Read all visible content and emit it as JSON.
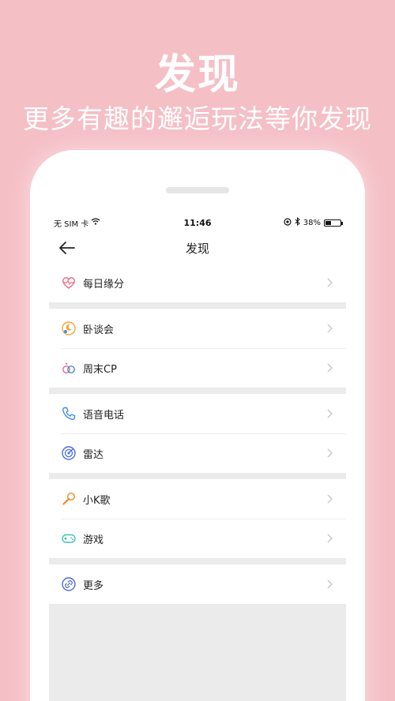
{
  "promo": {
    "title": "发现",
    "subtitle": "更多有趣的邂逅玩法等你发现"
  },
  "status_bar": {
    "carrier": "无 SIM 卡",
    "time": "11:46",
    "battery": "38%",
    "battery_level": 0.38
  },
  "nav": {
    "title": "发现"
  },
  "groups": [
    {
      "items": [
        {
          "label": "每日缘分",
          "icon": "heart-pulse-icon",
          "color": "#f06a84"
        }
      ]
    },
    {
      "items": [
        {
          "label": "卧谈会",
          "icon": "moon-chat-icon",
          "color": "#f5a53d"
        },
        {
          "label": "周末CP",
          "icon": "rings-icon",
          "color": "#e9658a"
        }
      ]
    },
    {
      "items": [
        {
          "label": "语音电话",
          "icon": "phone-icon",
          "color": "#3f8fe0"
        },
        {
          "label": "雷达",
          "icon": "radar-icon",
          "color": "#4a6ee0"
        }
      ]
    },
    {
      "items": [
        {
          "label": "小K歌",
          "icon": "microphone-icon",
          "color": "#f08a2c"
        },
        {
          "label": "游戏",
          "icon": "gamepad-icon",
          "color": "#3fc0b3"
        }
      ]
    },
    {
      "items": [
        {
          "label": "更多",
          "icon": "link-icon",
          "color": "#5568d8"
        }
      ]
    }
  ]
}
